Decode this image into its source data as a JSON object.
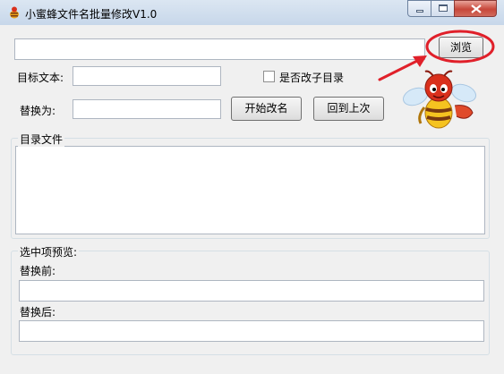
{
  "window": {
    "title": "小蜜蜂文件名批量修改V1.0"
  },
  "path_input": {
    "value": ""
  },
  "browse_button": {
    "label": "浏览"
  },
  "target_text": {
    "label": "目标文本:",
    "value": ""
  },
  "include_subdirs": {
    "label": "是否改子目录",
    "checked": false
  },
  "replace_with": {
    "label": "替换为:",
    "value": ""
  },
  "start_rename_button": {
    "label": "开始改名"
  },
  "undo_button": {
    "label": "回到上次"
  },
  "dir_files": {
    "legend": "目录文件",
    "items": []
  },
  "preview": {
    "legend": "选中项预览:",
    "before_label": "替换前:",
    "before_value": "",
    "after_label": "替换后:",
    "after_value": ""
  },
  "colors": {
    "annotation_red": "#e0202a",
    "bee_yellow": "#f5c320",
    "bee_red": "#d9301c"
  }
}
